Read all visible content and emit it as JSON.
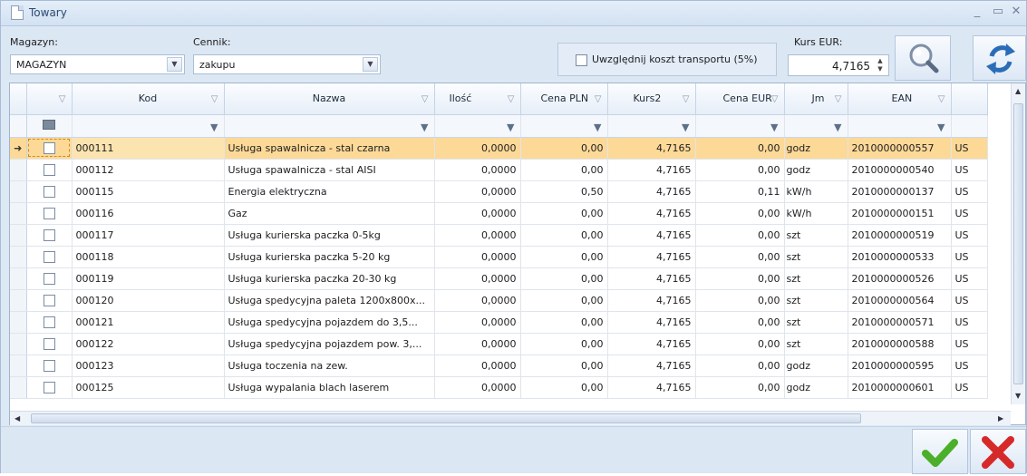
{
  "window": {
    "title": "Towary"
  },
  "filters": {
    "magazyn_label": "Magazyn:",
    "magazyn_value": "MAGAZYN",
    "cennik_label": "Cennik:",
    "cennik_value": "zakupu",
    "transport_label": "Uwzględnij koszt transportu (5%)",
    "transport_checked": false,
    "kurs_label": "Kurs EUR:",
    "kurs_value": "4,7165"
  },
  "icons": {
    "search": "magnifier-icon",
    "refresh": "refresh-icon",
    "ok": "checkmark-icon",
    "cancel": "red-x-icon"
  },
  "grid": {
    "columns": [
      "Kod",
      "Nazwa",
      "Ilość",
      "Cena PLN",
      "Kurs2",
      "Cena EUR",
      "Jm",
      "EAN"
    ],
    "rows": [
      {
        "kod": "000111",
        "nazwa": "Usługa spawalnicza - stal czarna",
        "ilosc": "0,0000",
        "cena_pln": "0,00",
        "kurs2": "4,7165",
        "cena_eur": "0,00",
        "jm": "godz",
        "ean": "2010000000557",
        "extra": "US",
        "selected": true
      },
      {
        "kod": "000112",
        "nazwa": "Usługa spawalnicza - stal AISI",
        "ilosc": "0,0000",
        "cena_pln": "0,00",
        "kurs2": "4,7165",
        "cena_eur": "0,00",
        "jm": "godz",
        "ean": "2010000000540",
        "extra": "US"
      },
      {
        "kod": "000115",
        "nazwa": "Energia elektryczna",
        "ilosc": "0,0000",
        "cena_pln": "0,50",
        "kurs2": "4,7165",
        "cena_eur": "0,11",
        "jm": "kW/h",
        "ean": "2010000000137",
        "extra": "US"
      },
      {
        "kod": "000116",
        "nazwa": "Gaz",
        "ilosc": "0,0000",
        "cena_pln": "0,00",
        "kurs2": "4,7165",
        "cena_eur": "0,00",
        "jm": "kW/h",
        "ean": "2010000000151",
        "extra": "US"
      },
      {
        "kod": "000117",
        "nazwa": "Usługa kurierska paczka 0-5kg",
        "ilosc": "0,0000",
        "cena_pln": "0,00",
        "kurs2": "4,7165",
        "cena_eur": "0,00",
        "jm": "szt",
        "ean": "2010000000519",
        "extra": "US"
      },
      {
        "kod": "000118",
        "nazwa": "Usługa kurierska paczka 5-20 kg",
        "ilosc": "0,0000",
        "cena_pln": "0,00",
        "kurs2": "4,7165",
        "cena_eur": "0,00",
        "jm": "szt",
        "ean": "2010000000533",
        "extra": "US"
      },
      {
        "kod": "000119",
        "nazwa": "Usługa kurierska paczka 20-30 kg",
        "ilosc": "0,0000",
        "cena_pln": "0,00",
        "kurs2": "4,7165",
        "cena_eur": "0,00",
        "jm": "szt",
        "ean": "2010000000526",
        "extra": "US"
      },
      {
        "kod": "000120",
        "nazwa": "Usługa spedycyjna paleta 1200x800x...",
        "ilosc": "0,0000",
        "cena_pln": "0,00",
        "kurs2": "4,7165",
        "cena_eur": "0,00",
        "jm": "szt",
        "ean": "2010000000564",
        "extra": "US"
      },
      {
        "kod": "000121",
        "nazwa": "Usługa spedycyjna pojazdem do 3,5...",
        "ilosc": "0,0000",
        "cena_pln": "0,00",
        "kurs2": "4,7165",
        "cena_eur": "0,00",
        "jm": "szt",
        "ean": "2010000000571",
        "extra": "US"
      },
      {
        "kod": "000122",
        "nazwa": "Usługa spedycyjna pojazdem pow. 3,...",
        "ilosc": "0,0000",
        "cena_pln": "0,00",
        "kurs2": "4,7165",
        "cena_eur": "0,00",
        "jm": "szt",
        "ean": "2010000000588",
        "extra": "US"
      },
      {
        "kod": "000123",
        "nazwa": "Usługa toczenia na zew.",
        "ilosc": "0,0000",
        "cena_pln": "0,00",
        "kurs2": "4,7165",
        "cena_eur": "0,00",
        "jm": "godz",
        "ean": "2010000000595",
        "extra": "US"
      },
      {
        "kod": "000125",
        "nazwa": "Usługa wypalania blach laserem",
        "ilosc": "0,0000",
        "cena_pln": "0,00",
        "kurs2": "4,7165",
        "cena_eur": "0,00",
        "jm": "godz",
        "ean": "2010000000601",
        "extra": "US"
      }
    ]
  },
  "colors": {
    "selected_row": "#fcd997",
    "accent_blue": "#2b6cb8",
    "ok_green": "#4caf2a",
    "cancel_red": "#d62a2a"
  }
}
